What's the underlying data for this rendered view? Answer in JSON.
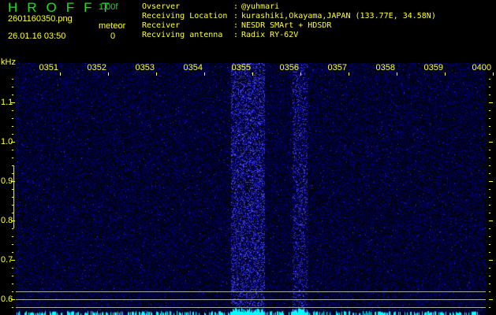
{
  "header": {
    "app_title": "HROFFT",
    "version": "1.00f",
    "filename": "2601160350.png",
    "datetime": "26.01.16 03:50",
    "meteor_label": "meteor",
    "meteor_count": "0"
  },
  "info": [
    {
      "label": "Ovserver",
      "value": "@yuhmari"
    },
    {
      "label": "Receiving Location",
      "value": "kurashiki,Okayama,JAPAN (133.77E, 34.58N)"
    },
    {
      "label": "Receiver",
      "value": "NESDR SMArt + HDSDR"
    },
    {
      "label": "Recviving antenna",
      "value": "Radix RY-62V"
    }
  ],
  "axis": {
    "y_unit": "kHz",
    "time_labels": [
      "0351",
      "0352",
      "0353",
      "0354",
      "0355",
      "0356",
      "0357",
      "0358",
      "0359",
      "0400"
    ],
    "freq_labels": [
      "1.1",
      "1.0",
      "0.9",
      "0.8",
      "0.7",
      "0.6"
    ]
  },
  "colors": {
    "noise": "#1010c0",
    "echo": "#2a2aff",
    "level": "#00ffff",
    "accent": "#ffff33",
    "title": "#22dd22"
  }
}
